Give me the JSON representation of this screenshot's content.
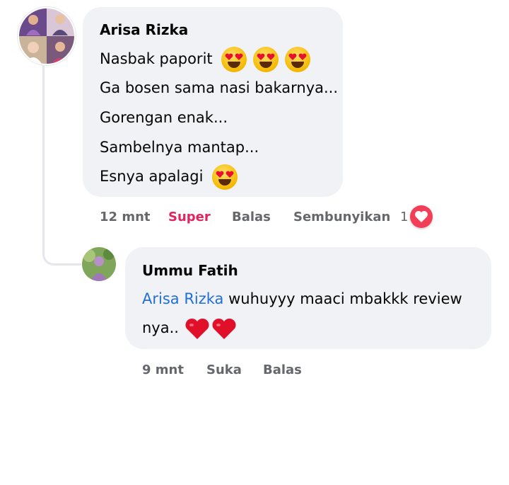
{
  "comment": {
    "author": "Arisa Rizka",
    "lines": [
      "Nasbak paporit",
      "Ga bosen sama nasi bakarnya...",
      "Gorengan enak...",
      "Sambelnya mantap...",
      "Esnya apalagi"
    ],
    "time": "12 mnt",
    "reaction_label": "Super",
    "reply_label": "Balas",
    "hide_label": "Sembunyikan",
    "reaction_count": "1"
  },
  "reply": {
    "author": "Ummu Fatih",
    "mention": "Arisa Rizka",
    "text_line1": "wuhuyyy maaci mbakkk review",
    "text_line2": "nya..",
    "time": "9 mnt",
    "like_label": "Suka",
    "reply_label": "Balas"
  },
  "colors": {
    "bubble": "#f0f2f5",
    "mention": "#216fdb",
    "super": "#e0245e",
    "heart": "#f33e58",
    "meta": "#65676b"
  },
  "icons": {
    "heart_eyes": "heart-eyes-emoji",
    "red_heart": "red-heart-emoji",
    "reaction": "love-reaction-icon"
  }
}
